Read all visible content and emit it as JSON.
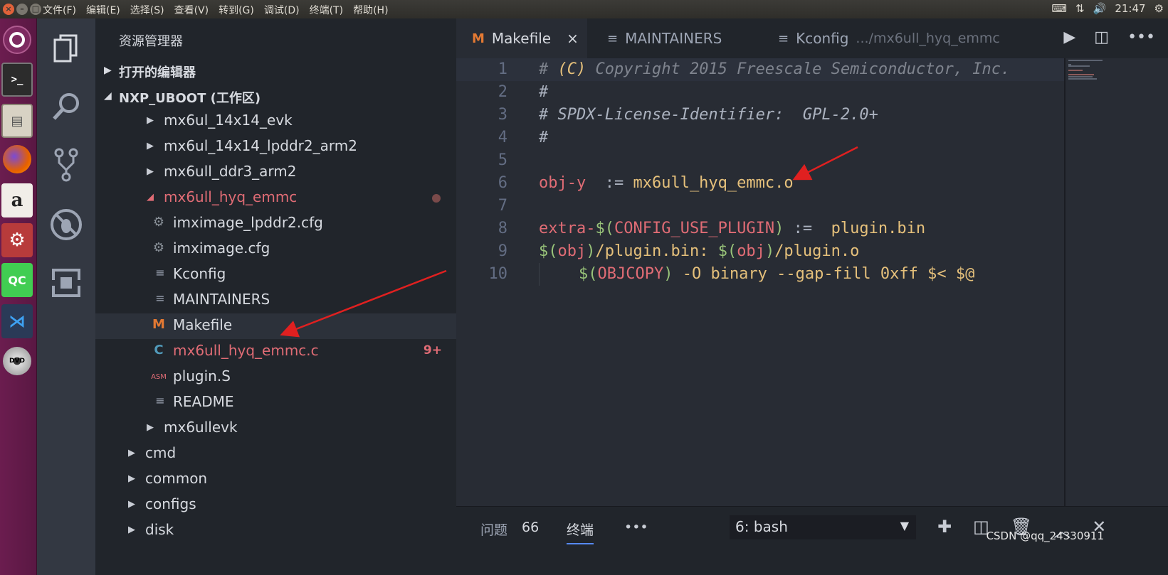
{
  "topbar": {
    "menus": [
      "文件(F)",
      "编辑(E)",
      "选择(S)",
      "查看(V)",
      "转到(G)",
      "调试(D)",
      "终端(T)",
      "帮助(H)"
    ],
    "time": "21:47"
  },
  "sidebar": {
    "title": "资源管理器",
    "open_editors": "打开的编辑器",
    "workspace": "NXP_UBOOT (工作区)",
    "items": [
      {
        "label": "mx6ul_14x14_evk"
      },
      {
        "label": "mx6ul_14x14_lpddr2_arm2"
      },
      {
        "label": "mx6ull_ddr3_arm2"
      },
      {
        "label": "mx6ull_hyq_emmc"
      },
      {
        "label": "imximage_lpddr2.cfg"
      },
      {
        "label": "imximage.cfg"
      },
      {
        "label": "Kconfig"
      },
      {
        "label": "MAINTAINERS"
      },
      {
        "label": "Makefile",
        "icon": "M"
      },
      {
        "label": "mx6ull_hyq_emmc.c",
        "icon": "C",
        "badge": "9+"
      },
      {
        "label": "plugin.S",
        "icon": "ASM"
      },
      {
        "label": "README"
      },
      {
        "label": "mx6ullevk"
      },
      {
        "label": "cmd"
      },
      {
        "label": "common"
      },
      {
        "label": "configs"
      },
      {
        "label": "disk"
      }
    ]
  },
  "tabs": {
    "t1": {
      "icon": "M",
      "label": "Makefile",
      "close": "×"
    },
    "t2": {
      "label": "MAINTAINERS"
    },
    "t3": {
      "label": "Kconfig",
      "desc": ".../mx6ull_hyq_emmc"
    }
  },
  "editor": {
    "lines": [
      "1",
      "2",
      "3",
      "4",
      "5",
      "6",
      "7",
      "8",
      "9",
      "10"
    ],
    "code": {
      "l1a": "# ",
      "l1b": "(C)",
      "l1c": " Copyright 2015 Freescale Semiconductor, Inc.",
      "l2": "#",
      "l3": "# SPDX-License-Identifier:  GPL-2.0+",
      "l4": "#",
      "l6a": "obj-y",
      "l6b": "  := ",
      "l6c": "mx6ull_hyq_emmc.o",
      "l8a": "extra-",
      "l8b": "$(",
      "l8c": "CONFIG_USE_PLUGIN",
      "l8d": ")",
      "l8e": " :=  ",
      "l8f": "plugin.bin",
      "l9a": "$(",
      "l9b": "obj",
      "l9c": ")",
      "l9d": "/plugin.bin: ",
      "l9e": "$(",
      "l9f": "obj",
      "l9g": ")",
      "l9h": "/plugin.o",
      "l10a": "$(",
      "l10b": "OBJCOPY",
      "l10c": ")",
      "l10d": " -O binary --gap-fill 0xff $< $@"
    }
  },
  "panel": {
    "problems": "问题",
    "problems_count": "66",
    "terminal": "终端",
    "more": "•••",
    "terminal_select": "6: bash",
    "watermark": "CSDN @qq_24330911"
  },
  "colors": {
    "accent": "#568af2",
    "modified": "#e06c75"
  }
}
